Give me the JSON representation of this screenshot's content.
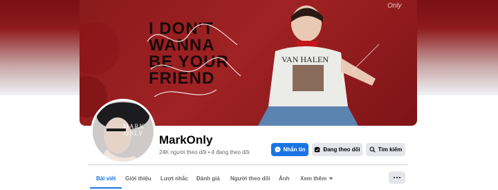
{
  "profile": {
    "name": "MarkOnly",
    "stats": "24K người theo dõi • 4 đang theo dõi",
    "avatar_text_line1": "MARK",
    "avatar_text_line2": "ONLY"
  },
  "cover": {
    "lines": [
      "I DON'T",
      "WANNA",
      "BE YOUR",
      "FRIEND"
    ],
    "watermark": "Only"
  },
  "actions": {
    "message_label": "Nhắn tin",
    "following_label": "Đang theo dõi",
    "search_label": "Tìm kiếm"
  },
  "tabs": [
    {
      "label": "Bài viết"
    },
    {
      "label": "Giới thiệu"
    },
    {
      "label": "Lượt nhắc"
    },
    {
      "label": "Đánh giá"
    },
    {
      "label": "Người theo dõi"
    },
    {
      "label": "Ảnh"
    },
    {
      "label": "Xem thêm"
    }
  ],
  "icons": {
    "messenger": "messenger-icon",
    "following": "following-icon",
    "search": "search-icon",
    "more": "more-icon"
  },
  "colors": {
    "accent": "#1b74e4",
    "cover": "#a02224"
  }
}
